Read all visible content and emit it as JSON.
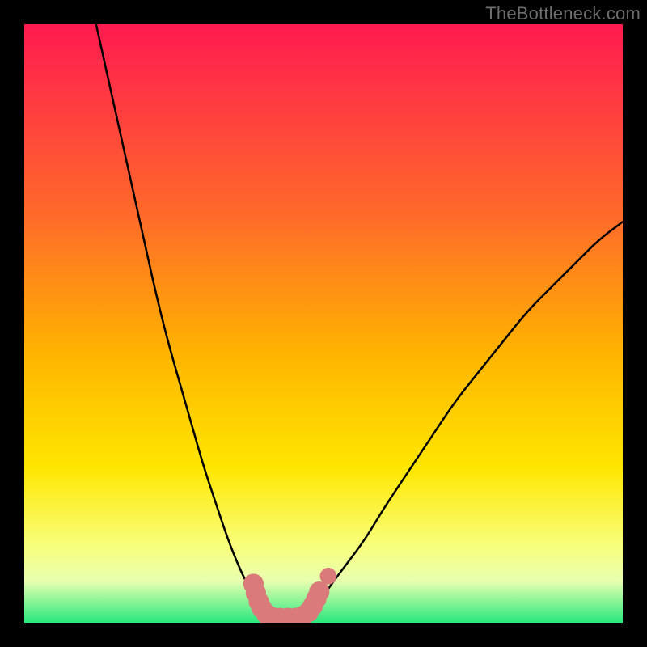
{
  "watermark": "TheBottleneck.com",
  "chart_data": {
    "type": "line",
    "title": "",
    "xlabel": "",
    "ylabel": "",
    "xlim": [
      0,
      100
    ],
    "ylim": [
      0,
      100
    ],
    "background_gradient": {
      "top": "#ff1b50",
      "mid1": "#ffb400",
      "mid2": "#ffe600",
      "mid3": "#f8ff7a",
      "bottom": "#27e87e"
    },
    "series": [
      {
        "name": "left-curve",
        "stroke": "#000000",
        "points": [
          {
            "x": 12,
            "y": 100
          },
          {
            "x": 14,
            "y": 91
          },
          {
            "x": 16,
            "y": 82
          },
          {
            "x": 18,
            "y": 73
          },
          {
            "x": 20,
            "y": 64
          },
          {
            "x": 22,
            "y": 55
          },
          {
            "x": 24,
            "y": 47
          },
          {
            "x": 26,
            "y": 40
          },
          {
            "x": 28,
            "y": 33
          },
          {
            "x": 30,
            "y": 26
          },
          {
            "x": 32,
            "y": 20
          },
          {
            "x": 34,
            "y": 14
          },
          {
            "x": 36,
            "y": 9
          },
          {
            "x": 38,
            "y": 5
          },
          {
            "x": 40,
            "y": 2
          },
          {
            "x": 41,
            "y": 1
          }
        ]
      },
      {
        "name": "right-curve",
        "stroke": "#000000",
        "points": [
          {
            "x": 47,
            "y": 1
          },
          {
            "x": 49,
            "y": 3
          },
          {
            "x": 51,
            "y": 6
          },
          {
            "x": 54,
            "y": 10
          },
          {
            "x": 57,
            "y": 14
          },
          {
            "x": 60,
            "y": 19
          },
          {
            "x": 64,
            "y": 25
          },
          {
            "x": 68,
            "y": 31
          },
          {
            "x": 72,
            "y": 37
          },
          {
            "x": 76,
            "y": 42
          },
          {
            "x": 80,
            "y": 47
          },
          {
            "x": 84,
            "y": 52
          },
          {
            "x": 88,
            "y": 56
          },
          {
            "x": 92,
            "y": 60
          },
          {
            "x": 96,
            "y": 64
          },
          {
            "x": 100,
            "y": 67
          }
        ]
      }
    ],
    "marker_cluster": {
      "name": "bottom-markers",
      "fill": "#da7a7a",
      "points": [
        {
          "x": 38.3,
          "y": 6.5,
          "r": 1.7
        },
        {
          "x": 38.7,
          "y": 5.0,
          "r": 1.7
        },
        {
          "x": 39.2,
          "y": 3.5,
          "r": 1.7
        },
        {
          "x": 39.7,
          "y": 2.4,
          "r": 1.7
        },
        {
          "x": 40.5,
          "y": 1.4,
          "r": 1.7
        },
        {
          "x": 41.5,
          "y": 0.9,
          "r": 1.7
        },
        {
          "x": 42.7,
          "y": 0.8,
          "r": 1.7
        },
        {
          "x": 44.0,
          "y": 0.8,
          "r": 1.7
        },
        {
          "x": 45.3,
          "y": 0.8,
          "r": 1.7
        },
        {
          "x": 46.5,
          "y": 1.1,
          "r": 1.7
        },
        {
          "x": 47.5,
          "y": 1.8,
          "r": 1.7
        },
        {
          "x": 48.2,
          "y": 2.8,
          "r": 1.7
        },
        {
          "x": 48.8,
          "y": 4.0,
          "r": 1.7
        },
        {
          "x": 49.3,
          "y": 5.2,
          "r": 1.7
        },
        {
          "x": 50.8,
          "y": 7.8,
          "r": 1.4
        }
      ]
    }
  }
}
